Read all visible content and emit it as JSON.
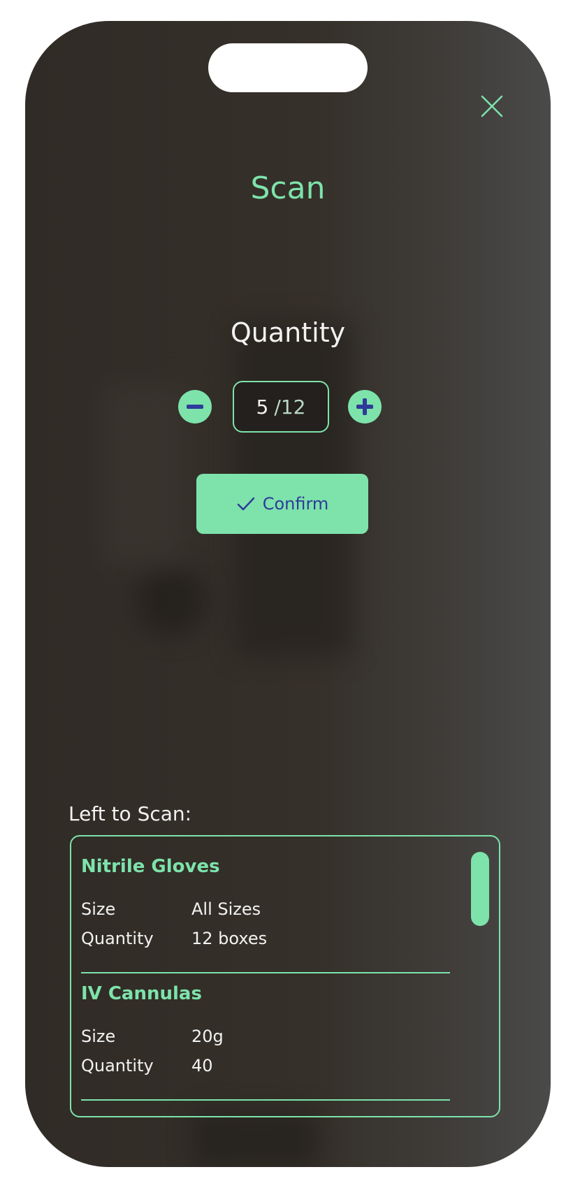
{
  "header": {
    "title": "Scan",
    "close_icon": "close-icon"
  },
  "quantity": {
    "label": "Quantity",
    "current": "5",
    "separator": "/",
    "total": "12",
    "decrement_icon": "minus-icon",
    "increment_icon": "plus-icon"
  },
  "confirm": {
    "label": "Confirm",
    "icon": "check-icon"
  },
  "left_to_scan": {
    "label": "Left to Scan:",
    "items": [
      {
        "name": "Nitrile Gloves",
        "size_label": "Size",
        "size_value": "All Sizes",
        "quantity_label": "Quantity",
        "quantity_value": "12 boxes"
      },
      {
        "name": "IV Cannulas",
        "size_label": "Size",
        "size_value": "20g",
        "quantity_label": "Quantity",
        "quantity_value": "40"
      }
    ]
  },
  "colors": {
    "accent": "#7de3ab",
    "accent_ink": "#2f3a9a",
    "background": "#302b26",
    "text": "#f2f2f2"
  }
}
